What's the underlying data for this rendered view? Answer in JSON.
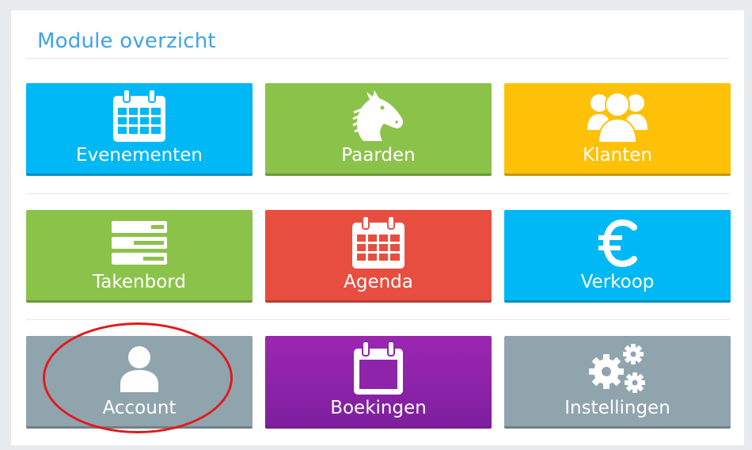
{
  "panel": {
    "title": "Module overzicht"
  },
  "colors": {
    "blue": "#00b8f5",
    "green": "#8bc34a",
    "yellow": "#ffc107",
    "red": "#e84e40",
    "purple": "#9224b0",
    "gray": "#90a4ae",
    "title": "#3fa3e8",
    "annotation": "#e01b1b"
  },
  "tiles": [
    {
      "label": "Evenementen",
      "icon": "calendar-icon",
      "color": "#00b8f5"
    },
    {
      "label": "Paarden",
      "icon": "horse-head-icon",
      "color": "#8bc34a"
    },
    {
      "label": "Klanten",
      "icon": "users-group-icon",
      "color": "#ffc107"
    },
    {
      "label": "Takenbord",
      "icon": "task-board-icon",
      "color": "#8bc34a"
    },
    {
      "label": "Agenda",
      "icon": "calendar-icon",
      "color": "#e84e40"
    },
    {
      "label": "Verkoop",
      "icon": "euro-icon",
      "color": "#00b8f5"
    },
    {
      "label": "Account",
      "icon": "user-icon",
      "color": "#90a4ae"
    },
    {
      "label": "Boekingen",
      "icon": "calendar-blank-icon",
      "color": "#9224b0"
    },
    {
      "label": "Instellingen",
      "icon": "gears-icon",
      "color": "#90a4ae"
    }
  ]
}
